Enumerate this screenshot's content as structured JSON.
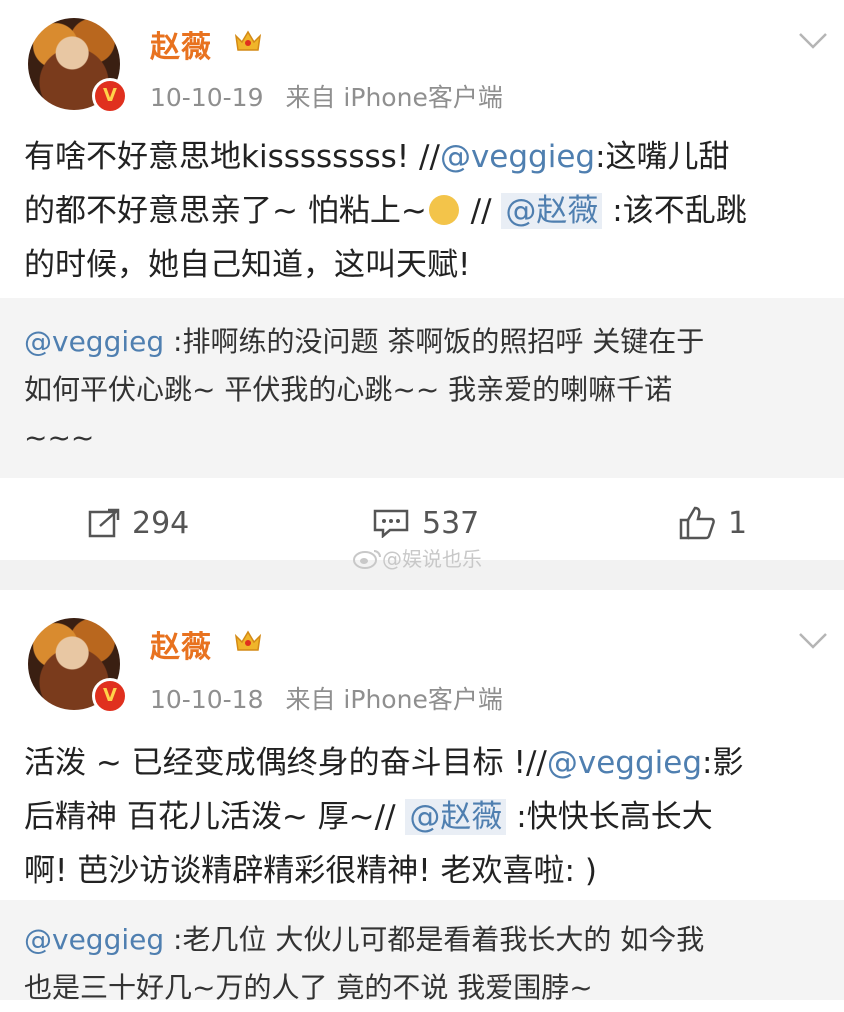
{
  "posts": [
    {
      "username": "赵薇",
      "date": "10-10-19",
      "source": "来自 iPhone客户端",
      "content": {
        "line1_a": "有啥不好意思地kissssssss! //",
        "line1_mention": "@veggieg",
        "line1_b": ":这嘴儿甜",
        "line2_a": "的都不好意思亲了~ 怕粘上~",
        "line2_b": " // ",
        "line2_mention": "@赵薇",
        "line2_c": " :该不乱跳",
        "line3": "的时候，她自己知道，这叫天赋!"
      },
      "retweet": {
        "mention": "@veggieg",
        "text1": " :排啊练的没问题 茶啊饭的照招呼 关键在于",
        "text2": "如何平伏心跳~ 平伏我的心跳~~ 我亲爱的喇嘛千诺",
        "text3": "~~~"
      },
      "actions": {
        "repost": "294",
        "comment": "537",
        "like": "1"
      }
    },
    {
      "username": "赵薇",
      "date": "10-10-18",
      "source": "来自 iPhone客户端",
      "content": {
        "line1_a": "活泼 ~ 已经变成偶终身的奋斗目标 !//",
        "line1_mention": "@veggieg",
        "line1_b": ":影",
        "line2_a": "后精神 百花儿活泼~ 厚~// ",
        "line2_mention": "@赵薇",
        "line2_b": " :快快长高长大",
        "line3": "啊! 芭沙访谈精辟精彩很精神! 老欢喜啦: )"
      },
      "retweet": {
        "mention": "@veggieg",
        "text1": " :老几位 大伙儿可都是看着我长大的 如今我",
        "text2": "也是三十好几~万的人了 竟的不说 我爱围脖~"
      }
    }
  ],
  "watermark": "@娱说也乐",
  "colors": {
    "username": "#e8721f",
    "mention": "#4f7fb0",
    "meta": "#8f8f8f",
    "vip_badge": "#e0301e"
  },
  "icons": [
    "chevron-down-icon",
    "crown-icon",
    "verified-v-icon",
    "repost-icon",
    "comment-icon",
    "like-icon",
    "weibo-logo-icon"
  ]
}
